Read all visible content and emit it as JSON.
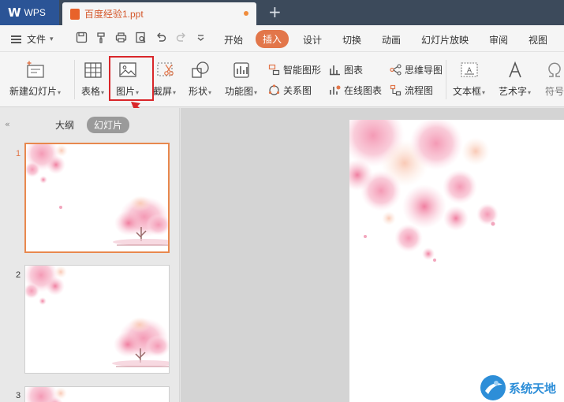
{
  "titlebar": {
    "app_name": "WPS",
    "logo_letter": "W",
    "document_tab": "百度经验1.ppt",
    "new_tab": "+"
  },
  "menubar": {
    "file_label": "文件",
    "items": [
      "开始",
      "插入",
      "设计",
      "切换",
      "动画",
      "幻灯片放映",
      "审阅",
      "视图"
    ],
    "active": "插入"
  },
  "ribbon": {
    "new_slide": "新建幻灯片",
    "table": "表格",
    "picture": "图片",
    "screenshot": "截屏",
    "shape": "形状",
    "function_chart": "功能图",
    "smart_art": "智能图形",
    "relation": "关系图",
    "chart": "图表",
    "online_chart": "在线图表",
    "mind_map": "思维导图",
    "flowchart": "流程图",
    "textbox": "文本框",
    "word_art": "艺术字",
    "symbol": "符号",
    "caret": "▾"
  },
  "sidepanel": {
    "tab_outline": "大纲",
    "tab_slides": "幻灯片",
    "collapse": "«",
    "slide_numbers": [
      "1",
      "2",
      "3"
    ]
  },
  "watermark": {
    "text": "系统天地"
  },
  "colors": {
    "accent": "#e2764a",
    "highlight_box": "#d9262a",
    "title_bar": "#3c4a5b",
    "wps_logo": "#2b5496"
  }
}
